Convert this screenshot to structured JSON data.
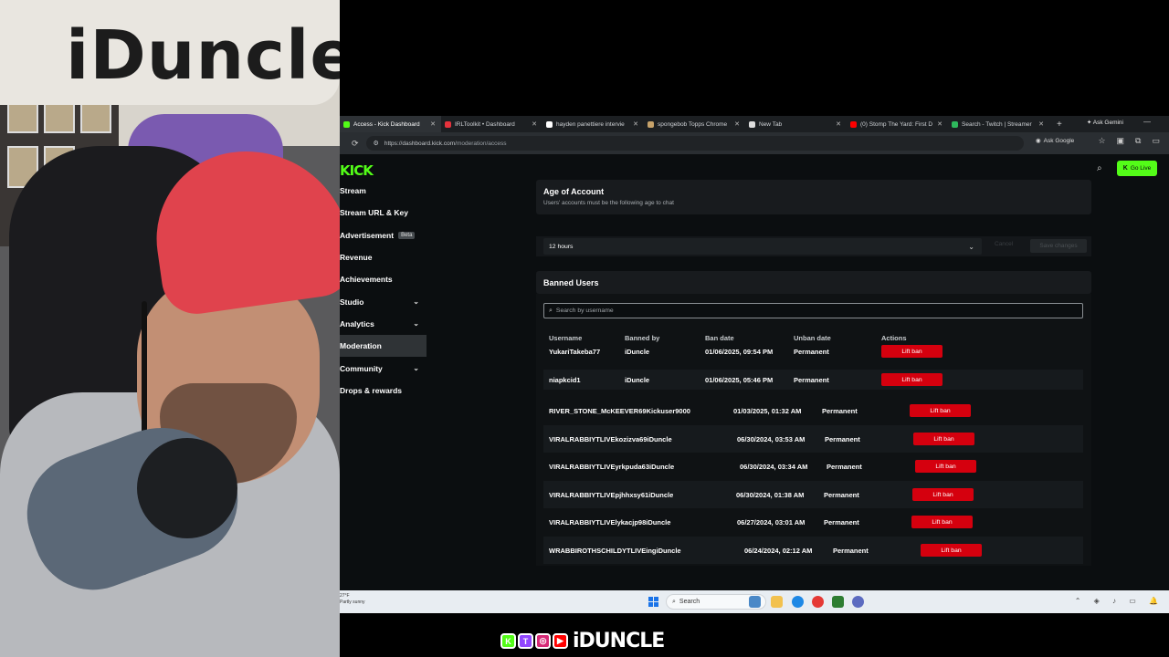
{
  "webcam": {
    "sign_text": "iDuncle"
  },
  "browser": {
    "tabs": [
      {
        "label": "Access - Kick Dashboard",
        "active": true,
        "favicon_color": "#53fc18"
      },
      {
        "label": "IRLToolkit • Dashboard",
        "active": false,
        "favicon_color": "#e5323c"
      },
      {
        "label": "hayden panettiere intervie",
        "active": false,
        "favicon_color": "#ffffff"
      },
      {
        "label": "spongebob Topps Chrome",
        "active": false,
        "favicon_color": "#c6a26a"
      },
      {
        "label": "New Tab",
        "active": false,
        "favicon_color": "#dddddd"
      },
      {
        "label": "(0) Stomp The Yard: First D",
        "active": false,
        "favicon_color": "#ff0000"
      },
      {
        "label": "Search - Twitch | Streamer",
        "active": false,
        "favicon_color": "#2eb85c"
      }
    ],
    "new_tab_icon": "plus-icon",
    "ask_gemini": "Ask Gemini",
    "url_host": "https://dashboard.kick.com",
    "url_path": "/moderation/access",
    "ask_google": "Ask Google"
  },
  "kick": {
    "logo": "KICK",
    "go_live": "Go Live",
    "brand_color": "#53fc18",
    "nav": [
      {
        "label": "Stream",
        "chevron": false,
        "active": false
      },
      {
        "label": "Stream URL & Key",
        "chevron": false,
        "active": false
      },
      {
        "label": "Advertisement",
        "chevron": false,
        "active": false,
        "badge": "Beta"
      },
      {
        "label": "Revenue",
        "chevron": false,
        "active": false
      },
      {
        "label": "Achievements",
        "chevron": false,
        "active": false
      },
      {
        "label": "Studio",
        "chevron": true,
        "active": false
      },
      {
        "label": "Analytics",
        "chevron": true,
        "active": false
      },
      {
        "label": "Moderation",
        "chevron": false,
        "active": true
      },
      {
        "label": "Community",
        "chevron": true,
        "active": false
      },
      {
        "label": "Drops & rewards",
        "chevron": false,
        "active": false
      }
    ],
    "age_section": {
      "title": "Age of Account",
      "subtitle": "Users' accounts must be the following age to chat",
      "selected": "12 hours",
      "cancel_label": "Cancel",
      "save_label": "Save changes"
    },
    "banned_section": {
      "title": "Banned Users",
      "search_placeholder": "Search by username",
      "columns": [
        "Username",
        "Banned by",
        "Ban date",
        "Unban date",
        "Actions"
      ],
      "lift_label": "Lift ban",
      "lift_color": "#d5000e",
      "rows": [
        {
          "username": "YukariTakeba77",
          "banned_by": "iDuncle",
          "ban_date": "01/06/2025, 09:54 PM",
          "unban_date": "Permanent"
        },
        {
          "username": "niapkcid1",
          "banned_by": "iDuncle",
          "ban_date": "01/06/2025, 05:46 PM",
          "unban_date": "Permanent"
        },
        {
          "username": "RIVER_STONE_McKEEVER69Kickuser9000",
          "banned_by": "",
          "ban_date": "01/03/2025, 01:32 AM",
          "unban_date": "Permanent"
        },
        {
          "username": "VIRALRABBIYTLIVEkozizva69iDuncle",
          "banned_by": "",
          "ban_date": "06/30/2024, 03:53 AM",
          "unban_date": "Permanent"
        },
        {
          "username": "VIRALRABBIYTLIVEyrkpuda63iDuncle",
          "banned_by": "",
          "ban_date": "06/30/2024, 03:34 AM",
          "unban_date": "Permanent"
        },
        {
          "username": "VIRALRABBIYTLIVEpjhhxsy61iDuncle",
          "banned_by": "",
          "ban_date": "06/30/2024, 01:38 AM",
          "unban_date": "Permanent"
        },
        {
          "username": "VIRALRABBIYTLIVElykacjp98iDuncle",
          "banned_by": "",
          "ban_date": "06/27/2024, 03:01 AM",
          "unban_date": "Permanent"
        },
        {
          "username": "WRABBIROTHSCHILDYTLIVEingiDuncle",
          "banned_by": "",
          "ban_date": "06/24/2024, 02:12 AM",
          "unban_date": "Permanent"
        }
      ]
    }
  },
  "taskbar": {
    "left_text_1": "27°F",
    "left_text_2": "Partly sunny",
    "search_label": "Search"
  },
  "overlay": {
    "handle": "iDUNCLE",
    "socials": [
      {
        "icon": "kick-icon",
        "glyph": "K",
        "color": "#53fc18"
      },
      {
        "icon": "twitch-icon",
        "glyph": "T",
        "color": "#9146ff"
      },
      {
        "icon": "instagram-icon",
        "glyph": "◎",
        "color": "#d62976"
      },
      {
        "icon": "youtube-icon",
        "glyph": "▶",
        "color": "#ff0000"
      }
    ]
  }
}
